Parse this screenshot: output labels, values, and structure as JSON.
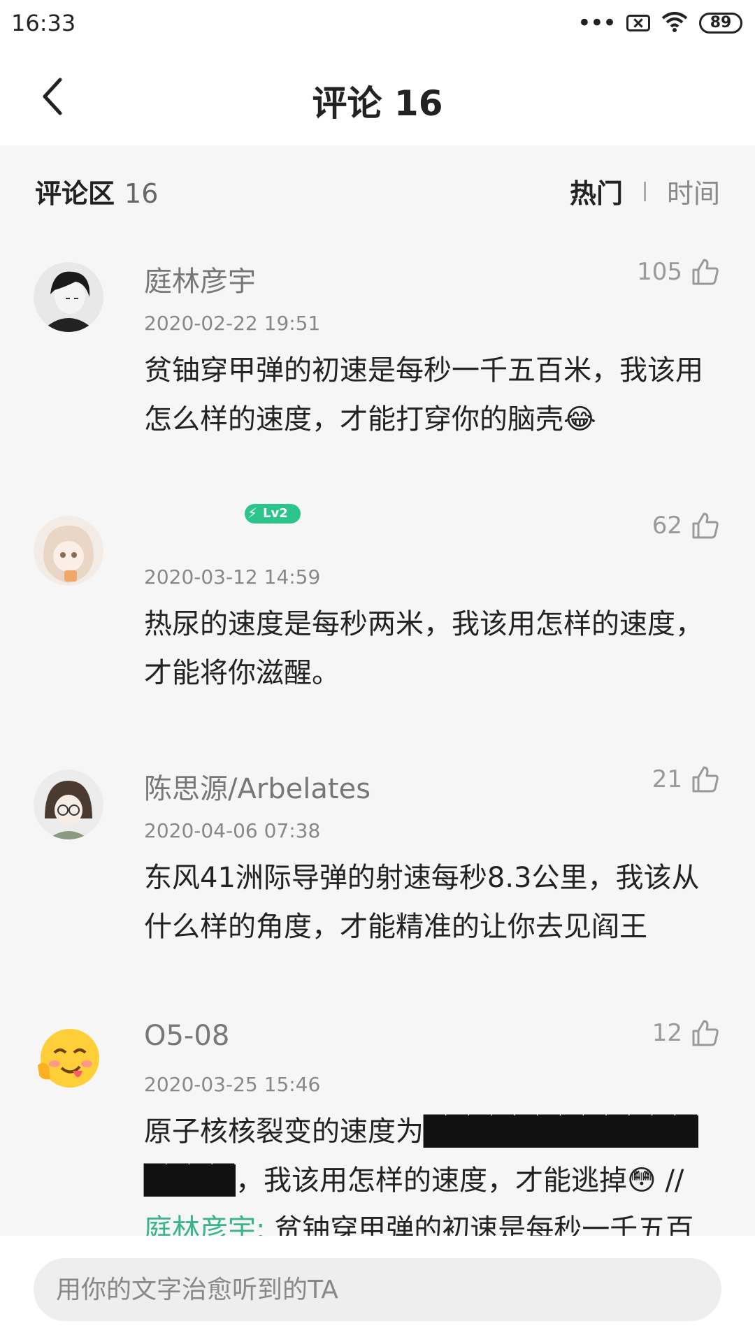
{
  "status_bar": {
    "time": "16:33",
    "battery": "89",
    "icons": [
      "more-dots-icon",
      "sim-off-icon",
      "wifi-icon",
      "battery-icon"
    ]
  },
  "header": {
    "title": "评论 16",
    "back_icon": "chevron-left-icon"
  },
  "section": {
    "title": "评论区",
    "count": "16",
    "sort_tabs": [
      {
        "label": "热门",
        "active": true
      },
      {
        "label": "时间",
        "active": false
      }
    ]
  },
  "comments": [
    {
      "username": "庭林彦宇",
      "time": "2020-02-22 19:51",
      "likes": "105",
      "text": "贫铀穿甲弹的初速是每秒一千五百米，我该用怎么样的速度，才能打穿你的脑壳😂",
      "avatar_icon": "avatar-anime-boy"
    },
    {
      "username": "",
      "badge": "Lv2",
      "time": "2020-03-12 14:59",
      "likes": "62",
      "text": "热尿的速度是每秒两米，我该用怎样的速度，才能将你滋醒。",
      "avatar_icon": "avatar-anime-girl"
    },
    {
      "username": "陈思源/Arbelates",
      "time": "2020-04-06 07:38",
      "likes": "21",
      "text": "东风41洲际导弹的射速每秒8.3公里，我该从什么样的角度，才能精准的让你去见阎王",
      "avatar_icon": "avatar-anime-glasses"
    },
    {
      "username": "O5-08",
      "time": "2020-03-25 15:46",
      "likes": "12",
      "text_before": "原子核核裂变的速度为",
      "redacted": "████████████████",
      "text_after": "，我该用怎样的速度，才能逃掉😳 // ",
      "mention": "庭林彦宇:",
      "text_tail": " 贫铀穿甲弹的初速是每秒一千五百米",
      "avatar_icon": "avatar-emoji-yum"
    }
  ],
  "input": {
    "placeholder": "用你的文字治愈听到的TA"
  },
  "colors": {
    "accent_green": "#3ab48a",
    "badge_green": "#2bc48a",
    "background": "#f6f6f6"
  }
}
